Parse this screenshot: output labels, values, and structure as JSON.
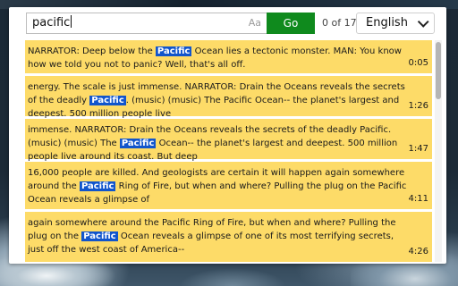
{
  "search": {
    "query": "pacific",
    "match_case_label": "Aa",
    "go_label": "Go",
    "count": "0 of 17"
  },
  "language": {
    "selected": "English"
  },
  "results": [
    {
      "pre": "NARRATOR: Deep below the ",
      "match": "Pacific",
      "post": " Ocean lies a tectonic monster. MAN: You know how we told you not to panic? Well, that's all off.",
      "time": "0:05"
    },
    {
      "pre": "energy. The scale is just immense. NARRATOR: Drain the Oceans reveals the secrets of the deadly ",
      "match": "Pacific",
      "post": ". (music) (music) The Pacific Ocean-- the planet's largest and deepest. 500 million people live",
      "time": "1:26"
    },
    {
      "pre": "immense. NARRATOR: Drain the Oceans reveals the secrets of the deadly Pacific. (music) (music) The ",
      "match": "Pacific",
      "post": " Ocean-- the planet's largest and deepest. 500 million people live around its coast. But deep",
      "time": "1:47"
    },
    {
      "pre": "16,000 people are killed. And geologists are certain it will happen again somewhere around the ",
      "match": "Pacific",
      "post": " Ring of Fire, but when and where? Pulling the plug on the Pacific Ocean reveals a glimpse of",
      "time": "4:11"
    },
    {
      "pre": "again somewhere around the Pacific Ring of Fire, but when and where? Pulling the plug on the ",
      "match": "Pacific",
      "post": " Ocean reveals a glimpse of one of its most terrifying secrets, just off the west coast of America--",
      "time": "4:26"
    }
  ],
  "colors": {
    "accent_go": "#0f8a1d",
    "result_bg": "#fddb68",
    "highlight": "#1155cc"
  }
}
